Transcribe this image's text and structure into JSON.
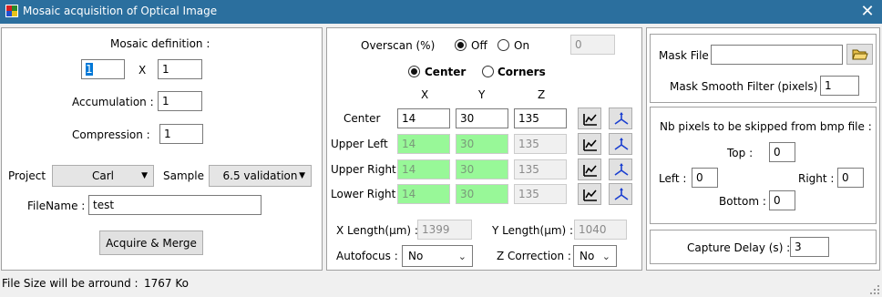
{
  "window": {
    "title": "Mosaic acquisition of Optical Image",
    "close_icon": "close-icon"
  },
  "left": {
    "mosaic_definition_label": "Mosaic definition :",
    "mosaic_x_value": "1",
    "x_sep": "X",
    "mosaic_y_value": "1",
    "accumulation_label": "Accumulation :",
    "accumulation_value": "1",
    "compression_label": "Compression :",
    "compression_value": "1",
    "project_label": "Project",
    "project_value": "Carl",
    "sample_label": "Sample",
    "sample_value": "6.5 validation",
    "filename_label": "FileName :",
    "filename_value": "test",
    "acquire_button": "Acquire & Merge"
  },
  "middle": {
    "overscan_label": "Overscan (%)",
    "overscan_off": "Off",
    "overscan_on": "On",
    "overscan_selected": "Off",
    "overscan_value": "0",
    "mode_center": "Center",
    "mode_corners": "Corners",
    "mode_selected": "Center",
    "col_x": "X",
    "col_y": "Y",
    "col_z": "Z",
    "rows": [
      {
        "label": "Center",
        "x": "14",
        "y": "30",
        "z": "135"
      },
      {
        "label": "Upper Left",
        "x": "14",
        "y": "30",
        "z": "135"
      },
      {
        "label": "Upper Right",
        "x": "14",
        "y": "30",
        "z": "135"
      },
      {
        "label": "Lower Right",
        "x": "14",
        "y": "30",
        "z": "135"
      }
    ],
    "x_length_label": "X Length(µm) :",
    "x_length_value": "1399",
    "y_length_label": "Y Length(µm) :",
    "y_length_value": "1040",
    "autofocus_label": "Autofocus :",
    "autofocus_value": "No",
    "z_correction_label": "Z Correction :",
    "z_correction_value": "No"
  },
  "right": {
    "mask_file_label": "Mask File :",
    "mask_file_value": "",
    "mask_smooth_label": "Mask Smooth Filter (pixels) :",
    "mask_smooth_value": "1",
    "skip_title": "Nb pixels to be skipped from bmp file :",
    "top_label": "Top :",
    "top_value": "0",
    "left_label": "Left :",
    "left_value": "0",
    "right_label": "Right :",
    "right_value": "0",
    "bottom_label": "Bottom :",
    "bottom_value": "0",
    "capture_delay_label": "Capture Delay (s) :",
    "capture_delay_value": "3"
  },
  "status": {
    "file_size_label": "File Size will be arround :",
    "file_size_value": "1767 Ko"
  }
}
